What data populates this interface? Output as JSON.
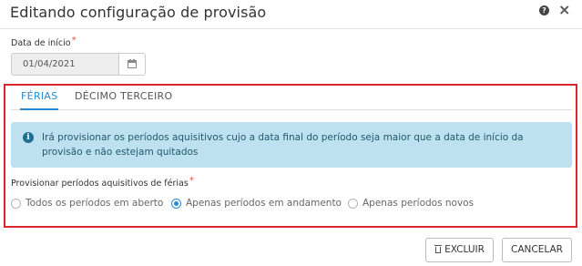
{
  "dialog": {
    "title": "Editando configuração de provisão",
    "help_icon": "question-circle-icon",
    "close_icon": "close-icon"
  },
  "start_date": {
    "label": "Data de início",
    "required_mark": "*",
    "value": "01/04/2021",
    "icon": "calendar-icon"
  },
  "tabs": [
    {
      "label": "FÉRIAS",
      "active": true
    },
    {
      "label": "DÉCIMO TERCEIRO",
      "active": false
    }
  ],
  "alert": {
    "icon": "info-icon",
    "icon_glyph": "i",
    "text": "Irá provisionar os períodos aquisitivos cujo a data final do período seja maior que a data de início da provisão e não estejam quitados"
  },
  "provision": {
    "label": "Provisionar períodos aquisitivos de férias",
    "required_mark": "*",
    "options": [
      {
        "label": "Todos os períodos em aberto",
        "selected": false
      },
      {
        "label": "Apenas períodos em andamento",
        "selected": true
      },
      {
        "label": "Apenas períodos novos",
        "selected": false
      }
    ]
  },
  "buttons": {
    "delete_label": "EXCLUIR",
    "delete_icon": "trash-icon",
    "cancel_label": "CANCELAR"
  },
  "colors": {
    "accent": "#2a8ad1",
    "highlight_frame": "#d9262c",
    "alert_bg": "#bde1ef",
    "required": "#d9534f"
  }
}
